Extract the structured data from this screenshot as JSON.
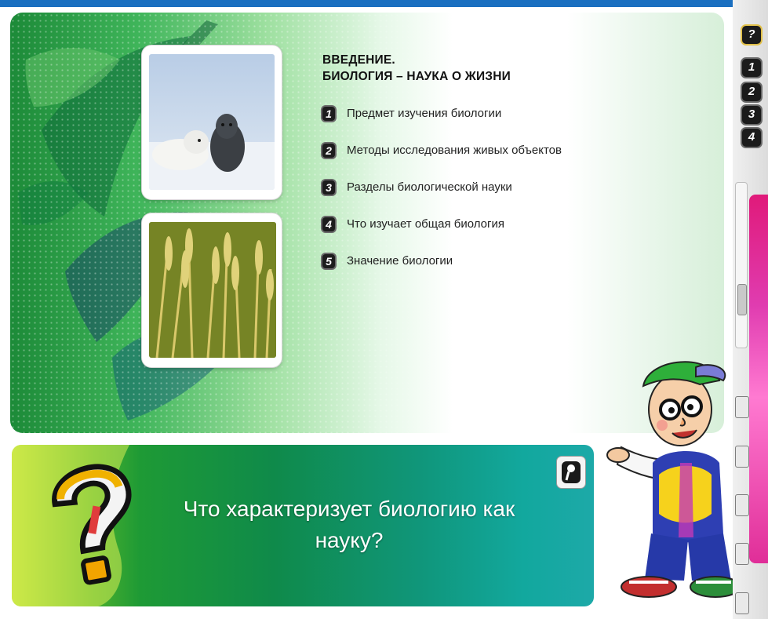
{
  "lesson": {
    "title_line1": "ВВЕДЕНИЕ.",
    "title_line2": "БИОЛОГИЯ – НАУКА О ЖИЗНИ",
    "topics": [
      {
        "num": "1",
        "label": "Предмет изучения биологии"
      },
      {
        "num": "2",
        "label": "Методы исследования живых объектов"
      },
      {
        "num": "3",
        "label": "Разделы биологической науки"
      },
      {
        "num": "4",
        "label": "Что изучает общая биология"
      },
      {
        "num": "5",
        "label": "Значение биологии"
      }
    ]
  },
  "question": {
    "text": "Что характеризует биологию как науку?"
  },
  "toolbar": {
    "buttons": [
      {
        "label": "?",
        "icon": "help-icon"
      },
      {
        "label": "1",
        "icon": "number-1-icon"
      },
      {
        "label": "2",
        "icon": "number-2-icon"
      },
      {
        "label": "3",
        "icon": "number-3-icon"
      },
      {
        "label": "4",
        "icon": "number-4-icon"
      }
    ]
  },
  "colors": {
    "banner_green": "#0f8a4a",
    "top_bar": "#1a6fc0",
    "side_strip": "#e01a7a"
  },
  "images": {
    "card_1": "seal-pups-photo",
    "card_2": "wheat-field-photo",
    "mascot": "cartoon-professor-mascot",
    "question_mark": "question-mark-graphic"
  }
}
